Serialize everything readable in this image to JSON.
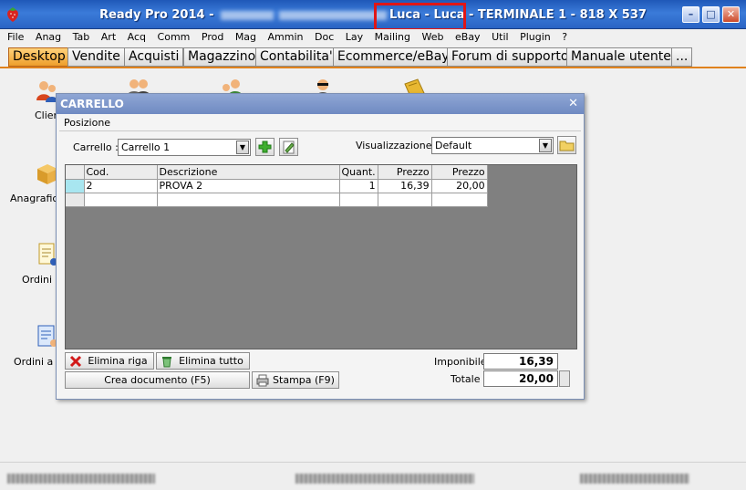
{
  "window": {
    "title_prefix": "Ready Pro 2014 - ",
    "title_user": "Luca - Luca",
    "title_suffix": " - TERMINALE 1 - 818 X 537",
    "minimize": "–",
    "maximize": "□",
    "close": "✕"
  },
  "menu": [
    "File",
    "Anag",
    "Tab",
    "Art",
    "Acq",
    "Comm",
    "Prod",
    "Mag",
    "Ammin",
    "Doc",
    "Lay",
    "Mailing",
    "Web",
    "eBay",
    "Util",
    "Plugin",
    "?"
  ],
  "tabs": [
    "Desktop",
    "Vendite",
    "Acquisti",
    "Magazzino",
    "Contabilita'",
    "Ecommerce/eBay",
    "Forum di supporto",
    "Manuale utente",
    "..."
  ],
  "desktop": {
    "labels": [
      "Clien",
      "Anagrafica",
      "Ordini c",
      "Ordini a fo"
    ]
  },
  "dialog": {
    "title": "CARRELLO",
    "close": "✕",
    "subtitle": "Posizione",
    "cart_label": "Carrello :",
    "cart_value": "Carrello 1",
    "view_label": "Visualizzazione :",
    "view_value": "Default",
    "grid": {
      "headers": [
        "Cod.",
        "Descrizione",
        "Quant.",
        "Prezzo",
        "Prezzo"
      ],
      "rows": [
        [
          "2",
          "PROVA 2",
          "1",
          "16,39",
          "20,00"
        ]
      ]
    },
    "buttons": {
      "delete_row": "Elimina riga",
      "delete_all": "Elimina tutto",
      "create_doc": "Crea documento (F5)",
      "print": "Stampa (F9)"
    },
    "totals": {
      "imponibile_label": "Imponibile",
      "imponibile_value": "16,39",
      "totale_label": "Totale",
      "totale_value": "20,00"
    }
  },
  "colors": {
    "titlebar": "#2a64c4",
    "active_tab": "#ee9e2c",
    "dialog_title": "#7b93c8",
    "grid_bg": "#808080",
    "highlight_box": "#e01616"
  }
}
